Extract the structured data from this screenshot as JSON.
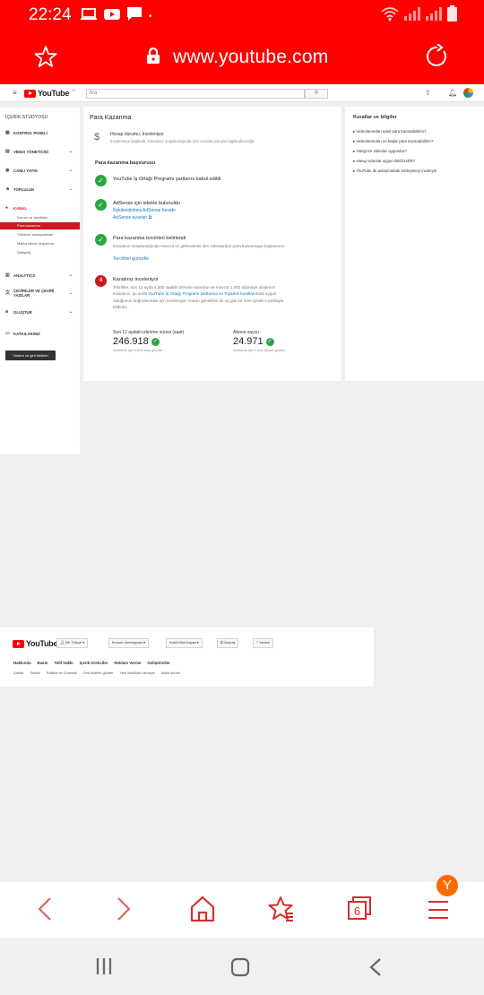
{
  "status_bar": {
    "time": "22:24"
  },
  "browser": {
    "url": "www.youtube.com",
    "tab_count": "6",
    "profile_initial": "Y"
  },
  "youtube_header": {
    "logo": "YouTube",
    "logo_suffix": "TR",
    "search_placeholder": "Ara"
  },
  "sidebar": {
    "title": "İÇERİK STÜDYOSU",
    "items": [
      {
        "label": "KONTROL PANELİ",
        "icon": "dashboard-icon"
      },
      {
        "label": "VİDEO YÖNETİCİSİ",
        "icon": "video-manager-icon"
      },
      {
        "label": "CANLI YAYIN",
        "icon": "live-icon"
      },
      {
        "label": "TOPLULUK",
        "icon": "community-icon"
      },
      {
        "label": "KANAL",
        "icon": "channel-icon"
      },
      {
        "label": "ANALYTICS",
        "icon": "analytics-icon"
      },
      {
        "label": "ÇEVİRİLER VE ÇEVİRİ YAZILAR",
        "icon": "translate-icon"
      },
      {
        "label": "OLUŞTUR",
        "icon": "create-icon"
      },
      {
        "label": "KATKILARINIZ",
        "icon": "contributions-icon"
      }
    ],
    "channel_subitems": [
      "Durum ve özellikler",
      "Para kazanma",
      "Yükleme varsayılanları",
      "Marka bilinci oluşturma",
      "Gelişmiş"
    ],
    "feedback_button": "Yardım ve geri bildirim"
  },
  "main": {
    "title": "Para Kazanma",
    "account_status": "Hesap durumu: İnceleniyor",
    "account_desc": "İncelemeye başlandı. Kanalınız onaylandığında size e-posta yoluyla bilgilendireceğiz.",
    "application_heading": "Para kazanma başvurusu",
    "steps": [
      {
        "title": "YouTube İş Ortağı Programı şartlarını kabul edildi"
      },
      {
        "title": "AdSense için istekte bulunuldu",
        "link1": "İlişkilendirilmiş AdSense hesabı",
        "link2": "AdSense ayarları ⧉"
      },
      {
        "title": "Para kazanma tercihleri belirlendi",
        "desc": "Kanalınız onaylandığında mevcut ve gelecekteki tüm videolardan para kazanmaya başlarsınız.",
        "link": "Tercihleri güncelle"
      },
      {
        "number": "4",
        "title": "Kanalınız inceleniyor",
        "desc_pre": "Tebrikler, son 12 ayda 4.000 saatlik izlenme süresine ve mevcut 1.000 aboneye ulaştınız! Kanalınız, şu anda ",
        "desc_link": "YouTube İş Ortağı Programı şartlarına ve Topluluk kurallarımıza",
        "desc_post": " uygun olduğunun doğrulanması için inceleniyor. Kararı genellikle bir ay gibi bir süre içinde e-postayla bildiririz."
      }
    ],
    "watch_time": {
      "label": "Son 12 aydaki izlenme süresi (saat)",
      "value": "246.918",
      "note": "İnceleme için 4.000 saat gerekir"
    },
    "subscribers": {
      "label": "Abone sayısı",
      "value": "24.971",
      "note": "İnceleme için 1.000 abone gerekir"
    }
  },
  "rules": {
    "title": "Kurallar ve bilgiler",
    "items": [
      "Videolarımdan nasıl para kazanabilirim?",
      "Videolarımdan ne kadar para kazanabilirim?",
      "Hangi tür videolar uygundur?",
      "Hangi videolar uygun DEĞİLDİR?",
      "YouTube ile anlaşmadaki sözleşmeyi inceleyin"
    ]
  },
  "footer": {
    "language": "Dil: Türkçe ▾",
    "location": "Konum: Azerbaycan ▾",
    "restricted": "Kısıtlı Mod Kapalı ▾",
    "history": "Geçmiş",
    "help": "Yardım",
    "links_primary": [
      "Hakkında",
      "Basın",
      "Telif hakkı",
      "İçerik Üreticiler",
      "Reklam Verme",
      "Geliştiriciler"
    ],
    "links_secondary": [
      "Şartlar",
      "Gizlilik",
      "Politika ve Güvenlik",
      "Geri bildirim gönder",
      "Yeni özellikleri deneyin",
      "Mobil sürüm"
    ]
  }
}
